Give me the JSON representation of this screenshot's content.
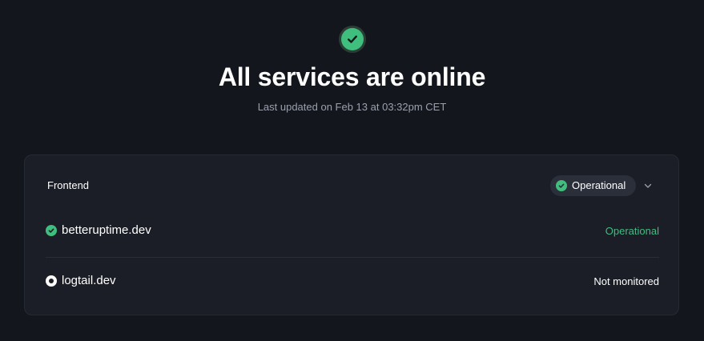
{
  "header": {
    "title": "All services are online",
    "subtitle": "Last updated on Feb 13 at 03:32pm CET",
    "status_icon": "check-circle-icon",
    "accent_color": "#3fbe7e"
  },
  "group": {
    "name": "Frontend",
    "status_label": "Operational",
    "expand_icon": "chevron-down-icon",
    "services": [
      {
        "name": "betteruptime.dev",
        "status": "Operational",
        "icon": "check-circle-icon",
        "status_color": "#3fbe7e"
      },
      {
        "name": "logtail.dev",
        "status": "Not monitored",
        "icon": "ring-icon",
        "status_color": "#ffffff"
      }
    ]
  }
}
